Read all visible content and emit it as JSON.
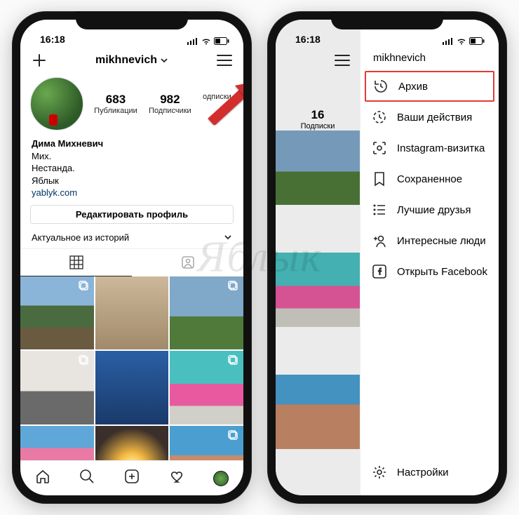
{
  "status": {
    "time": "16:18"
  },
  "profile": {
    "username": "mikhnevich",
    "stats": {
      "posts_num": "683",
      "posts_lbl": "Публикации",
      "followers_num": "982",
      "followers_lbl": "Подписчики",
      "following_num": "",
      "following_lbl": "одписки"
    },
    "bio_name": "Дима Михневич",
    "bio_line1": "Мих.",
    "bio_line2": "Нестанда.",
    "bio_line3": "Яблык",
    "bio_link": "yablyk.com",
    "edit_label": "Редактировать профиль",
    "highlights_label": "Актуальное из историй"
  },
  "menu": {
    "username": "mikhnevich",
    "left_stat_num": "16",
    "left_stat_lbl": "Подписки",
    "items": [
      {
        "label": "Архив"
      },
      {
        "label": "Ваши действия"
      },
      {
        "label": "Instagram-визитка"
      },
      {
        "label": "Сохраненное"
      },
      {
        "label": "Лучшие друзья"
      },
      {
        "label": "Интересные люди"
      },
      {
        "label": "Открыть Facebook"
      }
    ],
    "settings_label": "Настройки"
  },
  "watermark": "Яблык"
}
